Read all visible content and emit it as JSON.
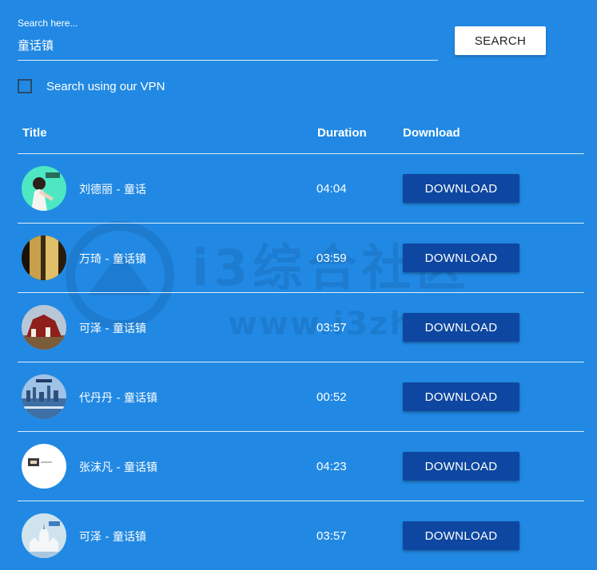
{
  "search": {
    "label": "Search here...",
    "value": "童话镇",
    "button_label": "SEARCH"
  },
  "vpn": {
    "label": "Search using our VPN",
    "checked": false
  },
  "table": {
    "headers": {
      "title": "Title",
      "duration": "Duration",
      "download": "Download"
    },
    "rows": [
      {
        "title": "刘德丽 - 童话",
        "duration": "04:04",
        "download_label": "DOWNLOAD",
        "thumb_icon": "album-cover-teal-portrait"
      },
      {
        "title": "万琦 - 童话镇",
        "duration": "03:59",
        "download_label": "DOWNLOAD",
        "thumb_icon": "album-cover-gold-curtain"
      },
      {
        "title": "可泽 - 童话镇",
        "duration": "03:57",
        "download_label": "DOWNLOAD",
        "thumb_icon": "album-cover-red-house"
      },
      {
        "title": "代丹丹 - 童话镇",
        "duration": "00:52",
        "download_label": "DOWNLOAD",
        "thumb_icon": "album-cover-city-skyline"
      },
      {
        "title": "张沫凡 - 童话镇",
        "duration": "04:23",
        "download_label": "DOWNLOAD",
        "thumb_icon": "album-cover-white-card"
      },
      {
        "title": "可泽 - 童话镇",
        "duration": "03:57",
        "download_label": "DOWNLOAD",
        "thumb_icon": "album-cover-castle"
      }
    ]
  },
  "watermark": {
    "text": "i3综合社区",
    "url": "www.i3zh.com"
  },
  "colors": {
    "background": "#2189e3",
    "download_button": "#0e47a1",
    "search_button": "#ffffff"
  }
}
